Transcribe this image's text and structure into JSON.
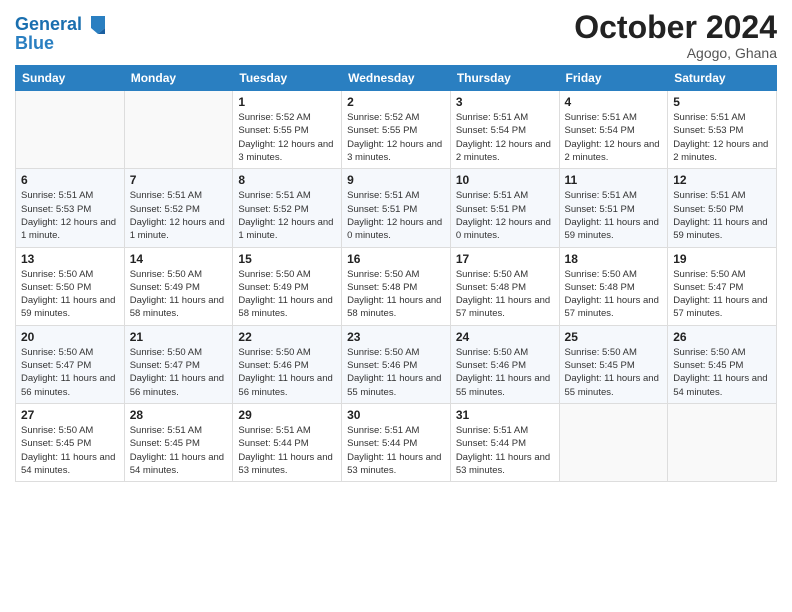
{
  "header": {
    "logo_line1": "General",
    "logo_line2": "Blue",
    "month_title": "October 2024",
    "location": "Agogo, Ghana"
  },
  "weekdays": [
    "Sunday",
    "Monday",
    "Tuesday",
    "Wednesday",
    "Thursday",
    "Friday",
    "Saturday"
  ],
  "weeks": [
    [
      {
        "day": "",
        "info": ""
      },
      {
        "day": "",
        "info": ""
      },
      {
        "day": "1",
        "info": "Sunrise: 5:52 AM\nSunset: 5:55 PM\nDaylight: 12 hours and 3 minutes."
      },
      {
        "day": "2",
        "info": "Sunrise: 5:52 AM\nSunset: 5:55 PM\nDaylight: 12 hours and 3 minutes."
      },
      {
        "day": "3",
        "info": "Sunrise: 5:51 AM\nSunset: 5:54 PM\nDaylight: 12 hours and 2 minutes."
      },
      {
        "day": "4",
        "info": "Sunrise: 5:51 AM\nSunset: 5:54 PM\nDaylight: 12 hours and 2 minutes."
      },
      {
        "day": "5",
        "info": "Sunrise: 5:51 AM\nSunset: 5:53 PM\nDaylight: 12 hours and 2 minutes."
      }
    ],
    [
      {
        "day": "6",
        "info": "Sunrise: 5:51 AM\nSunset: 5:53 PM\nDaylight: 12 hours and 1 minute."
      },
      {
        "day": "7",
        "info": "Sunrise: 5:51 AM\nSunset: 5:52 PM\nDaylight: 12 hours and 1 minute."
      },
      {
        "day": "8",
        "info": "Sunrise: 5:51 AM\nSunset: 5:52 PM\nDaylight: 12 hours and 1 minute."
      },
      {
        "day": "9",
        "info": "Sunrise: 5:51 AM\nSunset: 5:51 PM\nDaylight: 12 hours and 0 minutes."
      },
      {
        "day": "10",
        "info": "Sunrise: 5:51 AM\nSunset: 5:51 PM\nDaylight: 12 hours and 0 minutes."
      },
      {
        "day": "11",
        "info": "Sunrise: 5:51 AM\nSunset: 5:51 PM\nDaylight: 11 hours and 59 minutes."
      },
      {
        "day": "12",
        "info": "Sunrise: 5:51 AM\nSunset: 5:50 PM\nDaylight: 11 hours and 59 minutes."
      }
    ],
    [
      {
        "day": "13",
        "info": "Sunrise: 5:50 AM\nSunset: 5:50 PM\nDaylight: 11 hours and 59 minutes."
      },
      {
        "day": "14",
        "info": "Sunrise: 5:50 AM\nSunset: 5:49 PM\nDaylight: 11 hours and 58 minutes."
      },
      {
        "day": "15",
        "info": "Sunrise: 5:50 AM\nSunset: 5:49 PM\nDaylight: 11 hours and 58 minutes."
      },
      {
        "day": "16",
        "info": "Sunrise: 5:50 AM\nSunset: 5:48 PM\nDaylight: 11 hours and 58 minutes."
      },
      {
        "day": "17",
        "info": "Sunrise: 5:50 AM\nSunset: 5:48 PM\nDaylight: 11 hours and 57 minutes."
      },
      {
        "day": "18",
        "info": "Sunrise: 5:50 AM\nSunset: 5:48 PM\nDaylight: 11 hours and 57 minutes."
      },
      {
        "day": "19",
        "info": "Sunrise: 5:50 AM\nSunset: 5:47 PM\nDaylight: 11 hours and 57 minutes."
      }
    ],
    [
      {
        "day": "20",
        "info": "Sunrise: 5:50 AM\nSunset: 5:47 PM\nDaylight: 11 hours and 56 minutes."
      },
      {
        "day": "21",
        "info": "Sunrise: 5:50 AM\nSunset: 5:47 PM\nDaylight: 11 hours and 56 minutes."
      },
      {
        "day": "22",
        "info": "Sunrise: 5:50 AM\nSunset: 5:46 PM\nDaylight: 11 hours and 56 minutes."
      },
      {
        "day": "23",
        "info": "Sunrise: 5:50 AM\nSunset: 5:46 PM\nDaylight: 11 hours and 55 minutes."
      },
      {
        "day": "24",
        "info": "Sunrise: 5:50 AM\nSunset: 5:46 PM\nDaylight: 11 hours and 55 minutes."
      },
      {
        "day": "25",
        "info": "Sunrise: 5:50 AM\nSunset: 5:45 PM\nDaylight: 11 hours and 55 minutes."
      },
      {
        "day": "26",
        "info": "Sunrise: 5:50 AM\nSunset: 5:45 PM\nDaylight: 11 hours and 54 minutes."
      }
    ],
    [
      {
        "day": "27",
        "info": "Sunrise: 5:50 AM\nSunset: 5:45 PM\nDaylight: 11 hours and 54 minutes."
      },
      {
        "day": "28",
        "info": "Sunrise: 5:51 AM\nSunset: 5:45 PM\nDaylight: 11 hours and 54 minutes."
      },
      {
        "day": "29",
        "info": "Sunrise: 5:51 AM\nSunset: 5:44 PM\nDaylight: 11 hours and 53 minutes."
      },
      {
        "day": "30",
        "info": "Sunrise: 5:51 AM\nSunset: 5:44 PM\nDaylight: 11 hours and 53 minutes."
      },
      {
        "day": "31",
        "info": "Sunrise: 5:51 AM\nSunset: 5:44 PM\nDaylight: 11 hours and 53 minutes."
      },
      {
        "day": "",
        "info": ""
      },
      {
        "day": "",
        "info": ""
      }
    ]
  ]
}
